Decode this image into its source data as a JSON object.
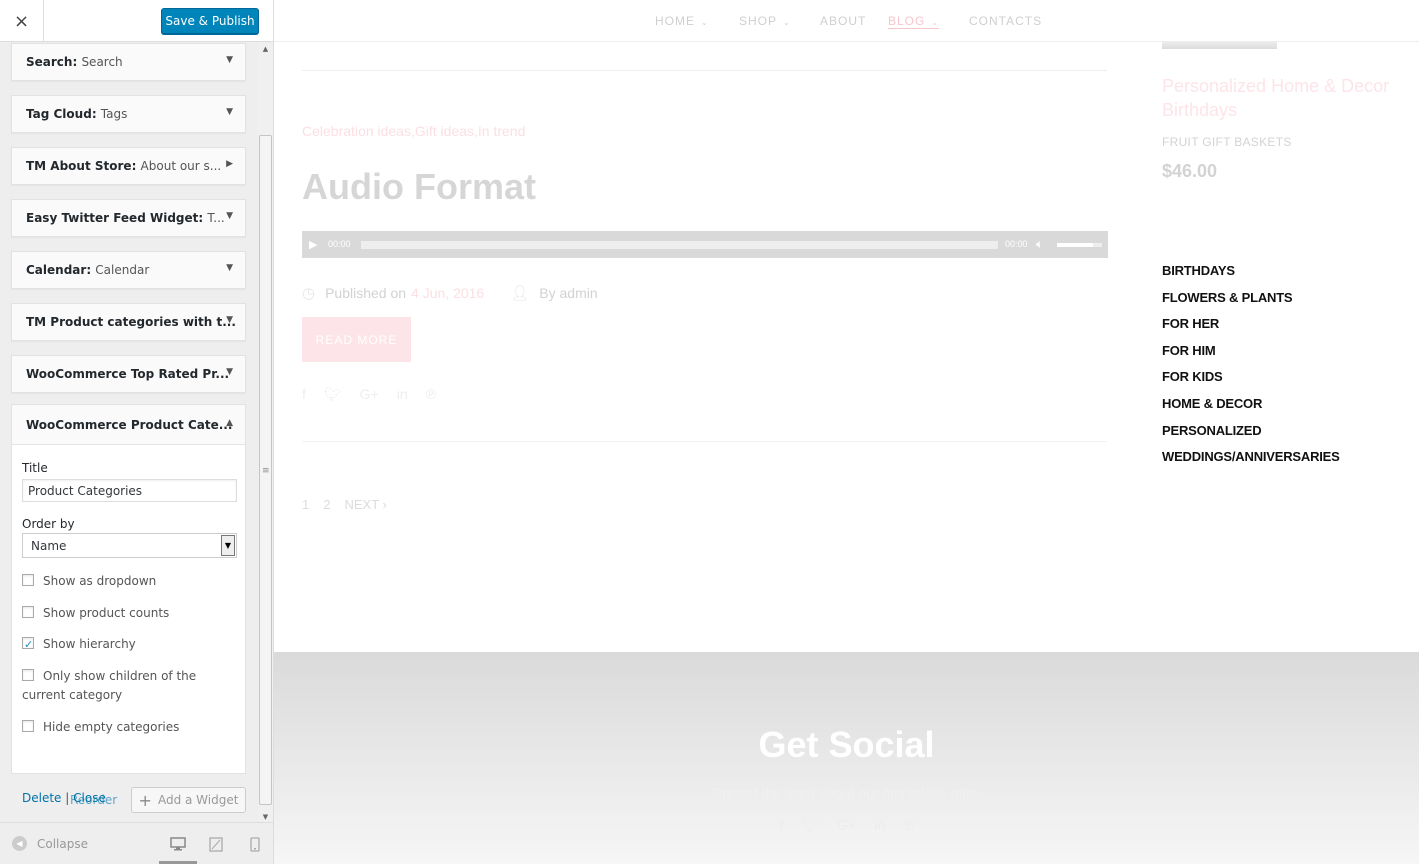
{
  "app": {
    "close_icon": "×",
    "publish_label": "Save & Publish"
  },
  "widgets": [
    {
      "type": "Search",
      "name": "Search",
      "state": "collapsed"
    },
    {
      "type": "Tag Cloud",
      "name": "Tags",
      "state": "collapsed"
    },
    {
      "type": "TM About Store",
      "name": "About our s...",
      "state": "collapsed-right"
    },
    {
      "type": "Easy Twitter Feed Widget",
      "name": "T...",
      "state": "collapsed"
    },
    {
      "type": "Calendar",
      "name": "Calendar",
      "state": "collapsed"
    },
    {
      "type": "TM Product categories with t...",
      "name": "",
      "state": "collapsed"
    },
    {
      "type": "WooCommerce Top Rated Pr...",
      "name": "",
      "state": "collapsed"
    }
  ],
  "open_widget": {
    "heading": "WooCommerce Product Cate...",
    "title_label": "Title",
    "title_value": "Product Categories",
    "orderby_label": "Order by",
    "orderby_value": "Name",
    "options": [
      {
        "label": "Show as dropdown",
        "checked": false
      },
      {
        "label": "Show product counts",
        "checked": false
      },
      {
        "label": "Show hierarchy",
        "checked": true
      },
      {
        "label": "Only show children of the current category",
        "checked": false
      },
      {
        "label": "Hide empty categories",
        "checked": false
      }
    ],
    "delete_label": "Delete",
    "separator": "|",
    "close_label": "Close"
  },
  "widget_actions": {
    "reorder_label": "Reorder",
    "add_label": "Add a Widget"
  },
  "footer_controls": {
    "collapse_label": "Collapse"
  },
  "site": {
    "nav": [
      "HOME",
      "SHOP",
      "ABOUT",
      "BLOG",
      "CONTACTS"
    ],
    "nav_active": "BLOG",
    "post": {
      "categories": "Celebration ideas,Gift ideas,In trend",
      "title": "Audio Format",
      "audio_current": "00:00",
      "audio_total": "00:00",
      "published_prefix": "Published on",
      "date": "4 Jun, 2016",
      "author": "By admin",
      "read_more": "READ MORE"
    },
    "pagination": [
      "1",
      "2",
      "NEXT ›"
    ],
    "product": {
      "name": "Personalized  Home & Decor Birthdays",
      "category": "FRUIT GIFT BASKETS",
      "price": "$46.00"
    },
    "product_categories": [
      "BIRTHDAYS",
      "FLOWERS & PLANTS",
      "FOR HER",
      "FOR HIM",
      "FOR KIDS",
      "HOME & DECOR",
      "PERSONALIZED",
      "WEDDINGS/ANNIVERSARIES"
    ],
    "footer_title": "Get Social",
    "footer_subtitle": "Spread the word about our marvelous gifts!"
  },
  "colors": {
    "primary_button": "#0085ba",
    "link": "#0073aa",
    "accent_pink": "#f7c6cd"
  }
}
